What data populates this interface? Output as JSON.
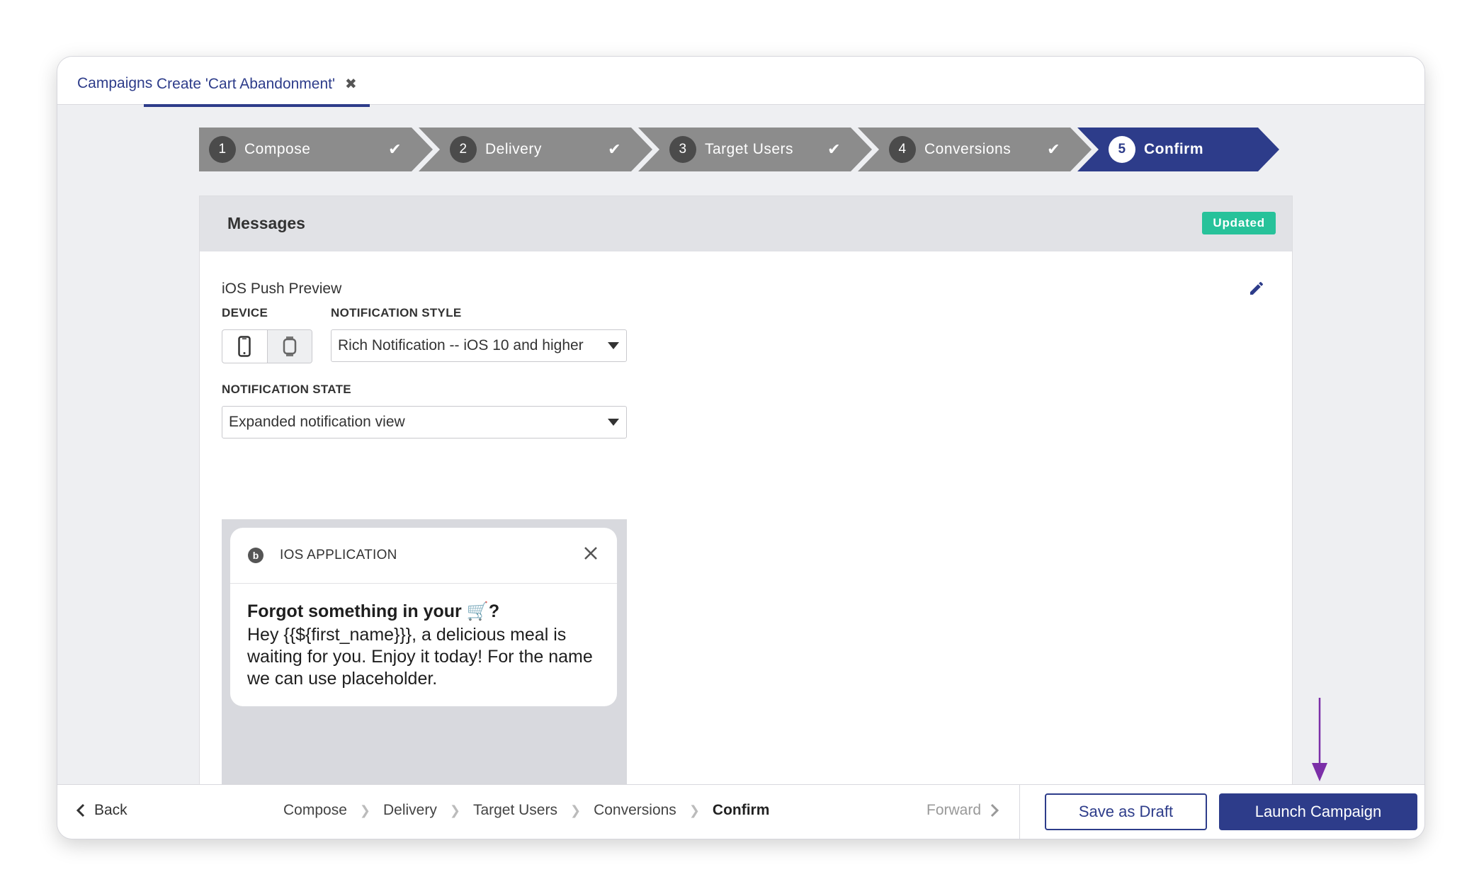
{
  "tabs": [
    {
      "label": "Campaigns"
    },
    {
      "label": "Create 'Cart Abandonment'"
    }
  ],
  "stepper": [
    {
      "num": "1",
      "label": "Compose",
      "done": true
    },
    {
      "num": "2",
      "label": "Delivery",
      "done": true
    },
    {
      "num": "3",
      "label": "Target Users",
      "done": true
    },
    {
      "num": "4",
      "label": "Conversions",
      "done": true
    },
    {
      "num": "5",
      "label": "Confirm",
      "done": false
    }
  ],
  "card": {
    "title": "Messages",
    "badge": "Updated",
    "preview_title": "iOS Push Preview",
    "device_label": "DEVICE",
    "style_label": "NOTIFICATION STYLE",
    "style_value": "Rich Notification -- iOS 10 and higher",
    "state_label": "NOTIFICATION STATE",
    "state_value": "Expanded notification view"
  },
  "notification": {
    "app_name": "IOS APPLICATION",
    "title": "Forgot something in your 🛒?",
    "body": "Hey {{${first_name}}}, a delicious meal is waiting for you. Enjoy it today! For the name we can use placeholder."
  },
  "footer": {
    "back": "Back",
    "crumbs": [
      "Compose",
      "Delivery",
      "Target Users",
      "Conversions",
      "Confirm"
    ],
    "forward": "Forward",
    "save_draft": "Save as Draft",
    "launch": "Launch Campaign"
  },
  "colors": {
    "brand": "#2d3c8a",
    "badge": "#27c29a",
    "step_done": "#8c8c8c",
    "annotation": "#7b2fa8"
  }
}
